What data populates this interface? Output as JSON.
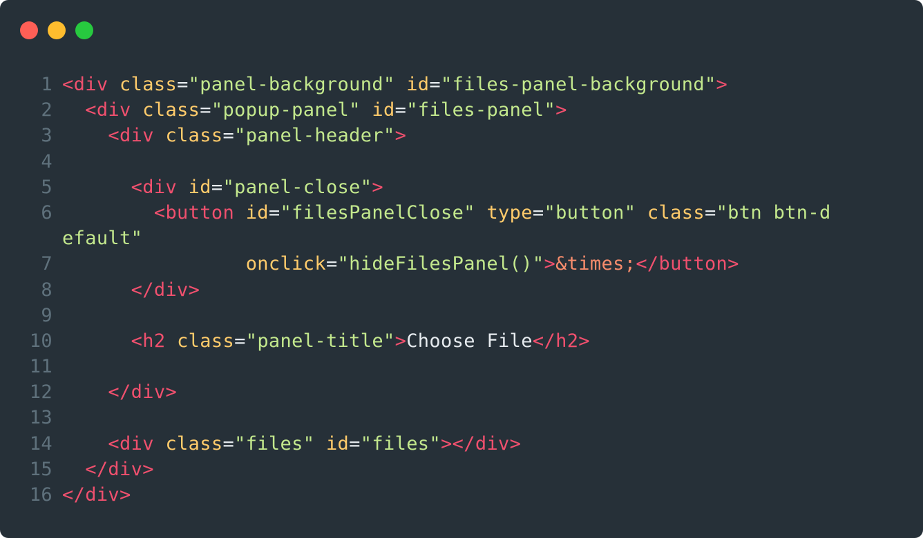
{
  "window": {
    "traffic_lights": [
      {
        "name": "close",
        "color": "#ff5f56"
      },
      {
        "name": "minimize",
        "color": "#ffbd2e"
      },
      {
        "name": "maximize",
        "color": "#27c93f"
      }
    ]
  },
  "theme": {
    "background": "#263038",
    "line_number": "#5f717c",
    "tag": "#f0506e",
    "attr": "#ffcb6b",
    "string": "#c3e88d",
    "text": "#e6ebef",
    "entity": "#f78c6c"
  },
  "code_lines": [
    {
      "n": "1",
      "tokens": [
        {
          "t": "<div",
          "k": "tag"
        },
        {
          "t": " ",
          "k": "text"
        },
        {
          "t": "class",
          "k": "attr"
        },
        {
          "t": "=",
          "k": "text"
        },
        {
          "t": "\"panel-background\"",
          "k": "string"
        },
        {
          "t": " ",
          "k": "text"
        },
        {
          "t": "id",
          "k": "attr"
        },
        {
          "t": "=",
          "k": "text"
        },
        {
          "t": "\"files-panel-background\"",
          "k": "string"
        },
        {
          "t": ">",
          "k": "tag"
        }
      ]
    },
    {
      "n": "2",
      "tokens": [
        {
          "t": "  ",
          "k": "text"
        },
        {
          "t": "<div",
          "k": "tag"
        },
        {
          "t": " ",
          "k": "text"
        },
        {
          "t": "class",
          "k": "attr"
        },
        {
          "t": "=",
          "k": "text"
        },
        {
          "t": "\"popup-panel\"",
          "k": "string"
        },
        {
          "t": " ",
          "k": "text"
        },
        {
          "t": "id",
          "k": "attr"
        },
        {
          "t": "=",
          "k": "text"
        },
        {
          "t": "\"files-panel\"",
          "k": "string"
        },
        {
          "t": ">",
          "k": "tag"
        }
      ]
    },
    {
      "n": "3",
      "tokens": [
        {
          "t": "    ",
          "k": "text"
        },
        {
          "t": "<div",
          "k": "tag"
        },
        {
          "t": " ",
          "k": "text"
        },
        {
          "t": "class",
          "k": "attr"
        },
        {
          "t": "=",
          "k": "text"
        },
        {
          "t": "\"panel-header\"",
          "k": "string"
        },
        {
          "t": ">",
          "k": "tag"
        }
      ]
    },
    {
      "n": "4",
      "tokens": []
    },
    {
      "n": "5",
      "tokens": [
        {
          "t": "      ",
          "k": "text"
        },
        {
          "t": "<div",
          "k": "tag"
        },
        {
          "t": " ",
          "k": "text"
        },
        {
          "t": "id",
          "k": "attr"
        },
        {
          "t": "=",
          "k": "text"
        },
        {
          "t": "\"panel-close\"",
          "k": "string"
        },
        {
          "t": ">",
          "k": "tag"
        }
      ]
    },
    {
      "n": "6",
      "wrap": true,
      "tokens": [
        {
          "t": "        ",
          "k": "text"
        },
        {
          "t": "<button",
          "k": "tag"
        },
        {
          "t": " ",
          "k": "text"
        },
        {
          "t": "id",
          "k": "attr"
        },
        {
          "t": "=",
          "k": "text"
        },
        {
          "t": "\"filesPanelClose\"",
          "k": "string"
        },
        {
          "t": " ",
          "k": "text"
        },
        {
          "t": "type",
          "k": "attr"
        },
        {
          "t": "=",
          "k": "text"
        },
        {
          "t": "\"button\"",
          "k": "string"
        },
        {
          "t": " ",
          "k": "text"
        },
        {
          "t": "class",
          "k": "attr"
        },
        {
          "t": "=",
          "k": "text"
        },
        {
          "t": "\"btn btn-default\"",
          "k": "string"
        }
      ]
    },
    {
      "n": "7",
      "tokens": [
        {
          "t": "                ",
          "k": "text"
        },
        {
          "t": "onclick",
          "k": "attr"
        },
        {
          "t": "=",
          "k": "text"
        },
        {
          "t": "\"hideFilesPanel()\"",
          "k": "string"
        },
        {
          "t": ">",
          "k": "tag"
        },
        {
          "t": "&times;",
          "k": "entity"
        },
        {
          "t": "</button>",
          "k": "tag"
        }
      ]
    },
    {
      "n": "8",
      "tokens": [
        {
          "t": "      ",
          "k": "text"
        },
        {
          "t": "</div>",
          "k": "tag"
        }
      ]
    },
    {
      "n": "9",
      "tokens": []
    },
    {
      "n": "10",
      "tokens": [
        {
          "t": "      ",
          "k": "text"
        },
        {
          "t": "<h2",
          "k": "tag"
        },
        {
          "t": " ",
          "k": "text"
        },
        {
          "t": "class",
          "k": "attr"
        },
        {
          "t": "=",
          "k": "text"
        },
        {
          "t": "\"panel-title\"",
          "k": "string"
        },
        {
          "t": ">",
          "k": "tag"
        },
        {
          "t": "Choose File",
          "k": "text"
        },
        {
          "t": "</h2>",
          "k": "tag"
        }
      ]
    },
    {
      "n": "11",
      "tokens": []
    },
    {
      "n": "12",
      "tokens": [
        {
          "t": "    ",
          "k": "text"
        },
        {
          "t": "</div>",
          "k": "tag"
        }
      ]
    },
    {
      "n": "13",
      "tokens": []
    },
    {
      "n": "14",
      "tokens": [
        {
          "t": "    ",
          "k": "text"
        },
        {
          "t": "<div",
          "k": "tag"
        },
        {
          "t": " ",
          "k": "text"
        },
        {
          "t": "class",
          "k": "attr"
        },
        {
          "t": "=",
          "k": "text"
        },
        {
          "t": "\"files\"",
          "k": "string"
        },
        {
          "t": " ",
          "k": "text"
        },
        {
          "t": "id",
          "k": "attr"
        },
        {
          "t": "=",
          "k": "text"
        },
        {
          "t": "\"files\"",
          "k": "string"
        },
        {
          "t": "></div>",
          "k": "tag"
        }
      ]
    },
    {
      "n": "15",
      "tokens": [
        {
          "t": "  ",
          "k": "text"
        },
        {
          "t": "</div>",
          "k": "tag"
        }
      ]
    },
    {
      "n": "16",
      "tokens": [
        {
          "t": "</div>",
          "k": "tag"
        }
      ]
    }
  ]
}
